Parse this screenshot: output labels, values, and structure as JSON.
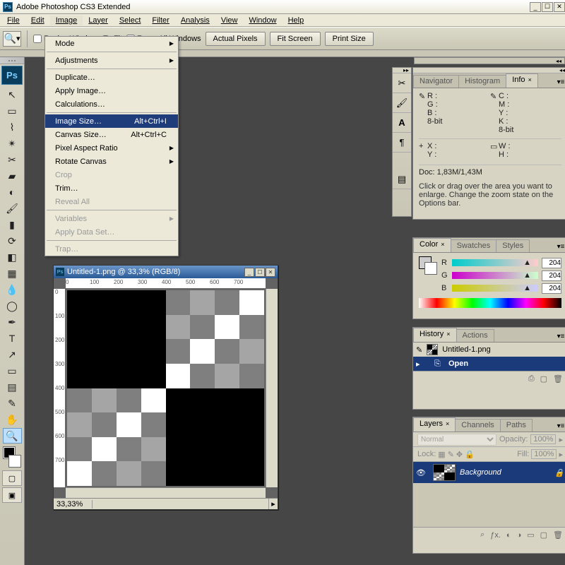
{
  "app": {
    "title": "Adobe Photoshop CS3 Extended"
  },
  "menubar": [
    "File",
    "Edit",
    "Image",
    "Layer",
    "Select",
    "Filter",
    "Analysis",
    "View",
    "Window",
    "Help"
  ],
  "optbar": {
    "resize": "Resize Windows To Fit",
    "zoomall": "Zoom All Windows",
    "actual": "Actual Pixels",
    "fit": "Fit Screen",
    "print": "Print Size"
  },
  "dropdown": {
    "mode": "Mode",
    "adjustments": "Adjustments",
    "duplicate": "Duplicate…",
    "applyimage": "Apply Image…",
    "calculations": "Calculations…",
    "imagesize": "Image Size…",
    "imagesize_sc": "Alt+Ctrl+I",
    "canvassize": "Canvas Size…",
    "canvassize_sc": "Alt+Ctrl+C",
    "par": "Pixel Aspect Ratio",
    "rotate": "Rotate Canvas",
    "crop": "Crop",
    "trim": "Trim…",
    "reveal": "Reveal All",
    "variables": "Variables",
    "applydata": "Apply Data Set…",
    "trap": "Trap…"
  },
  "doc": {
    "title": "Untitled-1.png @ 33,3% (RGB/8)",
    "zoom": "33,33%",
    "ruler_ticks": [
      "0",
      "100",
      "200",
      "300",
      "400",
      "500",
      "600",
      "700"
    ],
    "pixels": [
      [
        0,
        0,
        0,
        0,
        3,
        2,
        3,
        1
      ],
      [
        0,
        0,
        0,
        0,
        2,
        3,
        1,
        3
      ],
      [
        0,
        0,
        0,
        0,
        3,
        1,
        3,
        2
      ],
      [
        0,
        0,
        0,
        0,
        1,
        3,
        2,
        3
      ],
      [
        3,
        2,
        3,
        1,
        0,
        0,
        0,
        0
      ],
      [
        2,
        3,
        1,
        3,
        0,
        0,
        0,
        0
      ],
      [
        3,
        1,
        3,
        2,
        0,
        0,
        0,
        0
      ],
      [
        1,
        3,
        2,
        3,
        0,
        0,
        0,
        0
      ]
    ],
    "palette": [
      "#000000",
      "#ffffff",
      "#a5a5a5",
      "#7f7f7f"
    ]
  },
  "info": {
    "tabs": [
      "Navigator",
      "Histogram",
      "Info"
    ],
    "r": "R :",
    "g": "G :",
    "b": "B :",
    "c": "C :",
    "m": "M :",
    "y": "Y :",
    "k": "K :",
    "bit": "8-bit",
    "x": "X :",
    "yv": "Y :",
    "w": "W :",
    "h": "H :",
    "doc": "Doc: 1,83M/1,43M",
    "hint": "Click or drag over the area you want to enlarge. Change the zoom state on the Options bar."
  },
  "color": {
    "tabs": [
      "Color",
      "Swatches",
      "Styles"
    ],
    "r": "R",
    "g": "G",
    "b": "B",
    "rv": "204",
    "gv": "204",
    "bv": "204"
  },
  "history": {
    "tabs": [
      "History",
      "Actions"
    ],
    "docname": "Untitled-1.png",
    "open": "Open"
  },
  "layers": {
    "tabs": [
      "Layers",
      "Channels",
      "Paths"
    ],
    "blend": "Normal",
    "opacity_l": "Opacity:",
    "opacity_v": "100%",
    "lock": "Lock:",
    "fill_l": "Fill:",
    "fill_v": "100%",
    "bg": "Background"
  }
}
